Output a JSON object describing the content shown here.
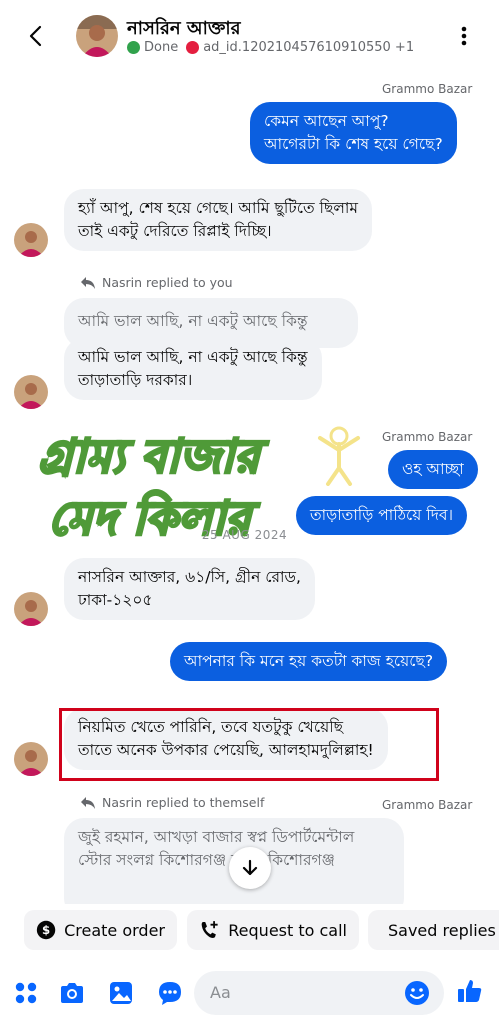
{
  "header": {
    "name": "নাসরিন আক্তার",
    "status_done": "Done",
    "ad_label": "ad_id.120210457610910550 +1",
    "colors": {
      "done_dot": "#31a24c",
      "ad_dot": "#e41e3f"
    }
  },
  "messages": {
    "m1_sender": "Grammo Bazar",
    "m1_line1": "কেমন আছেন আপু?",
    "m1_line2": "আগেরটা কি শেষ হয়ে গেছে?",
    "m2_line1": "হ্যাঁ আপু, শেষ হয়ে গেছে। আমি ছুটিতে ছিলাম",
    "m2_line2": "তাই একটু দেরিতে রিপ্লাই দিচ্ছি।",
    "m3_reply_tag": "Nasrin replied to you",
    "m3_quoted": "আমি ভাল আছি, না একটু আছে কিন্তু",
    "m3_line1": "আমি ভাল আছি, না একটু আছে কিন্তু",
    "m3_line2": "তাড়াতাড়ি দরকার।",
    "m4_sender": "Grammo Bazar",
    "m4_text": "ওহ আচ্ছা",
    "m5_text": "তাড়াতাড়ি পাঠিয়ে দিব।",
    "date": "25 AUG 2024",
    "m6_line1": "নাসরিন আক্তার, ৬১/সি, গ্রীন রোড,",
    "m6_line2": "ঢাকা-১২০৫",
    "m7_text": "আপনার কি মনে হয় কতটা কাজ হয়েছে?",
    "m8_line1": "নিয়মিত খেতে পারিনি, তবে যতটুকু খেয়েছি",
    "m8_line2": "তাতে অনেক উপকার পেয়েছি, আলহামদুলিল্লাহ!",
    "m9_reply_tag": "Nasrin replied to themself",
    "m9_sender": "Grammo Bazar",
    "m9_line1": "জুই রহমান, আখড়া বাজার স্বপ্ন ডিপার্টমেন্টাল",
    "m9_line2": "স্টোর সংলগ্ন কিশোরগঞ্জ সদর, কিশোরগঞ্জ"
  },
  "watermark": {
    "line1": "গ্রাম্য বাজার",
    "line2": "মেদ কিলার"
  },
  "actions": {
    "create_order": "Create order",
    "request_call": "Request to call",
    "saved_replies": "Saved replies"
  },
  "composer": {
    "placeholder": "Aa"
  }
}
